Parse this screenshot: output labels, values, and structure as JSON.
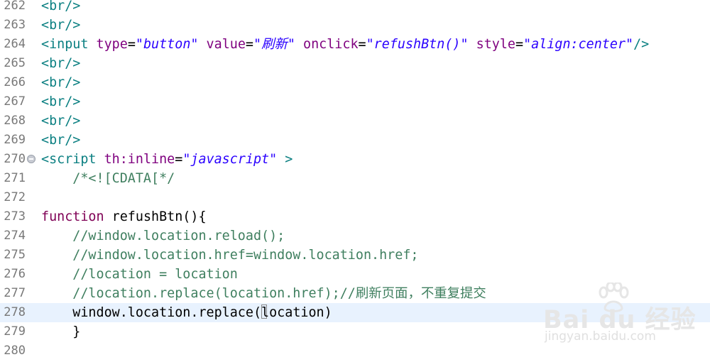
{
  "editor": {
    "lines": [
      {
        "num": "262",
        "tokens": [
          {
            "c": "tag",
            "t": "<br/>"
          }
        ]
      },
      {
        "num": "263",
        "tokens": [
          {
            "c": "tag",
            "t": "<br/>"
          }
        ]
      },
      {
        "num": "264",
        "tokens": [
          {
            "c": "tag",
            "t": "<input "
          },
          {
            "c": "attr",
            "t": "type"
          },
          {
            "c": "eq",
            "t": "="
          },
          {
            "c": "str",
            "t": "\"button\""
          },
          {
            "c": "eq",
            "t": " "
          },
          {
            "c": "attr",
            "t": "value"
          },
          {
            "c": "eq",
            "t": "="
          },
          {
            "c": "str",
            "t": "\"刷新\""
          },
          {
            "c": "eq",
            "t": " "
          },
          {
            "c": "attr",
            "t": "onclick"
          },
          {
            "c": "eq",
            "t": "="
          },
          {
            "c": "str",
            "t": "\"refushBtn()\""
          },
          {
            "c": "eq",
            "t": " "
          },
          {
            "c": "attr",
            "t": "style"
          },
          {
            "c": "eq",
            "t": "="
          },
          {
            "c": "str",
            "t": "\"align:center\""
          },
          {
            "c": "tag",
            "t": "/>"
          }
        ]
      },
      {
        "num": "265",
        "tokens": [
          {
            "c": "tag",
            "t": "<br/>"
          }
        ]
      },
      {
        "num": "266",
        "tokens": [
          {
            "c": "tag",
            "t": "<br/>"
          }
        ]
      },
      {
        "num": "267",
        "tokens": [
          {
            "c": "tag",
            "t": "<br/>"
          }
        ]
      },
      {
        "num": "268",
        "tokens": [
          {
            "c": "tag",
            "t": "<br/>"
          }
        ]
      },
      {
        "num": "269",
        "tokens": [
          {
            "c": "tag",
            "t": "<br/>"
          }
        ]
      },
      {
        "num": "270",
        "fold": true,
        "tokens": [
          {
            "c": "tag",
            "t": "<script "
          },
          {
            "c": "attr",
            "t": "th:inline"
          },
          {
            "c": "eq",
            "t": "="
          },
          {
            "c": "str",
            "t": "\"javascript\""
          },
          {
            "c": "tag",
            "t": " >"
          }
        ]
      },
      {
        "num": "271",
        "tokens": [
          {
            "c": "cmt",
            "t": "    /*<![CDATA[*/"
          }
        ]
      },
      {
        "num": "272",
        "tokens": []
      },
      {
        "num": "273",
        "tokens": [
          {
            "c": "kw",
            "t": "function"
          },
          {
            "c": "id",
            "t": " refushBtn(){"
          }
        ]
      },
      {
        "num": "274",
        "tokens": [
          {
            "c": "cmt",
            "t": "    //window.location.reload();"
          }
        ]
      },
      {
        "num": "275",
        "tokens": [
          {
            "c": "cmt",
            "t": "    //window.location.href=window.location.href;"
          }
        ]
      },
      {
        "num": "276",
        "tokens": [
          {
            "c": "cmt",
            "t": "    //location = location"
          }
        ]
      },
      {
        "num": "277",
        "tokens": [
          {
            "c": "cmt",
            "t": "    //location.replace(location.href);//刷新页面，不重复提交"
          }
        ]
      },
      {
        "num": "278",
        "current": true,
        "tokens": [
          {
            "c": "id",
            "t": "    window.location.replace("
          },
          {
            "c": "caret",
            "t": ""
          },
          {
            "c": "id",
            "t": "location)"
          }
        ]
      },
      {
        "num": "279",
        "tokens": [
          {
            "c": "id",
            "t": "    }"
          }
        ]
      },
      {
        "num": "280",
        "tokens": []
      }
    ]
  },
  "watermark": {
    "brand": "Bai du 经验",
    "url": "jingyan.baidu.com"
  }
}
